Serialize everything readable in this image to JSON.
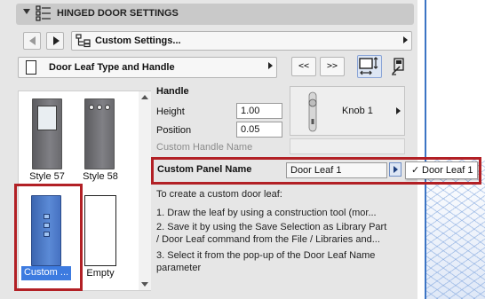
{
  "header": {
    "title": "HINGED DOOR SETTINGS"
  },
  "settings_row": {
    "dropdown_label": "Custom Settings..."
  },
  "page_row": {
    "dropdown_label": "Door Leaf Type and Handle",
    "prev_button": "<<",
    "next_button": ">>"
  },
  "gallery": {
    "items": [
      {
        "label": "Style 57"
      },
      {
        "label": "Style 58"
      },
      {
        "label": "Custom ..."
      },
      {
        "label": "Empty"
      }
    ],
    "selected_index": 2
  },
  "handle": {
    "section_title": "Handle",
    "height_label": "Height",
    "height_value": "1.00",
    "position_label": "Position",
    "position_value": "0.05",
    "custom_handle_name_label": "Custom Handle Name",
    "preview_label": "Knob 1"
  },
  "custom_panel": {
    "label": "Custom Panel Name",
    "value": "Door Leaf 1",
    "popup_item": "Door Leaf 1",
    "popup_checkmark": "✓"
  },
  "help": {
    "line1": "To create a custom door leaf:",
    "line2": "1. Draw the leaf by using a construction tool (mor...",
    "line3": "2. Save it by using the Save Selection as Library Part",
    "line4": "/ Door Leaf command from the File / Libraries and...",
    "line5": "3. Select it from the pop-up of the Door Leaf Name",
    "line6": "parameter"
  },
  "colors": {
    "accent": "#3d7be0",
    "highlight_border": "#b22025",
    "side_line": "#3c74c4"
  }
}
